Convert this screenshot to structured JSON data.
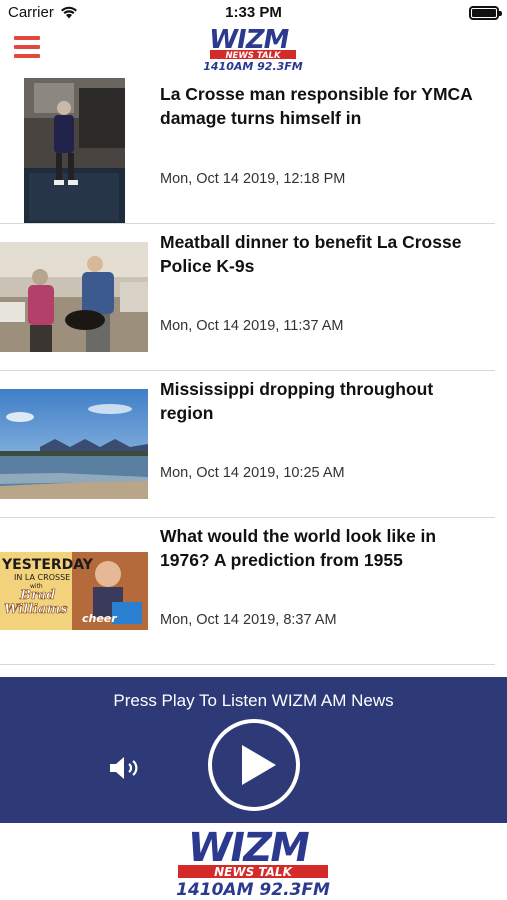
{
  "status_bar": {
    "carrier": "Carrier",
    "time": "1:33 PM"
  },
  "header": {
    "logo": {
      "wordmark": "WIZM",
      "tagline": "NEWS TALK",
      "frequency": "1410AM 92.3FM"
    }
  },
  "articles": [
    {
      "title": "La Crosse man responsible for YMCA damage turns himself in",
      "date": "Mon, Oct 14 2019, 12:18 PM",
      "thumb": "ymca-suspect-photo"
    },
    {
      "title": "Meatball dinner to benefit La Crosse Police K-9s",
      "date": "Mon, Oct 14 2019, 11:37 AM",
      "thumb": "meatball-dinner-photo"
    },
    {
      "title": "Mississippi dropping throughout region",
      "date": "Mon, Oct 14 2019, 10:25 AM",
      "thumb": "mississippi-river-bridge-photo"
    },
    {
      "title": "What would the world look like in 1976? A prediction from 1955",
      "date": "Mon, Oct 14 2019, 8:37 AM",
      "thumb": "yesterday-in-la-crosse-graphic",
      "thumb_text": {
        "line1": "YESTERDAY",
        "line2": "IN LA CROSSE",
        "line3": "with",
        "line4": "Brad",
        "line5": "Williams",
        "line6": "cheer"
      }
    }
  ],
  "player": {
    "prompt": "Press Play To Listen WIZM AM News"
  },
  "colors": {
    "accent_red": "#e2483b",
    "player_navy": "#2e3a78",
    "logo_blue": "#2b3a8f",
    "logo_red": "#d42a2a"
  }
}
